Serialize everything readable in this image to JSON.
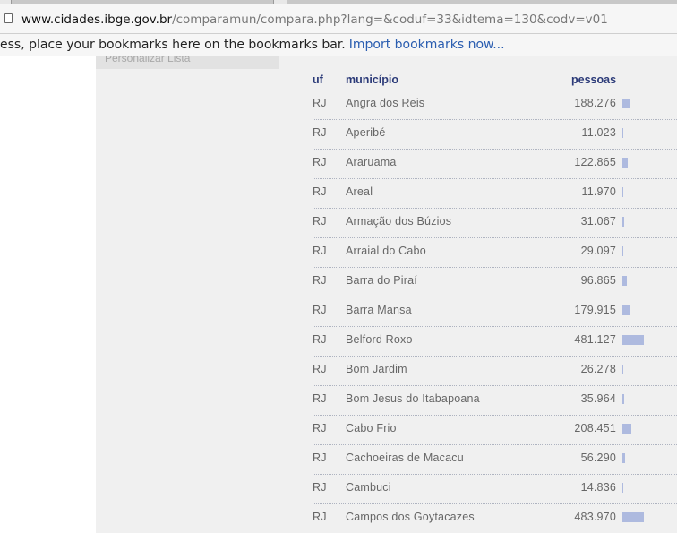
{
  "browser": {
    "url_host": "www.cidades.ibge.gov.br",
    "url_path": "/comparamun/compara.php?lang=&coduf=33&idtema=130&codv=v01",
    "bookmarks_message": "ess, place your bookmarks here on the bookmarks bar.",
    "bookmarks_link": "Import bookmarks now..."
  },
  "sidebar": {
    "item_label": "Personalizar Lista"
  },
  "table": {
    "headers": {
      "uf": "uf",
      "municipio": "município",
      "pessoas": "pessoas"
    },
    "max_value": 483970,
    "rows": [
      {
        "uf": "RJ",
        "municipio": "Angra dos Reis",
        "pessoas": "188.276",
        "value": 188276
      },
      {
        "uf": "RJ",
        "municipio": "Aperibé",
        "pessoas": "11.023",
        "value": 11023
      },
      {
        "uf": "RJ",
        "municipio": "Araruama",
        "pessoas": "122.865",
        "value": 122865
      },
      {
        "uf": "RJ",
        "municipio": "Areal",
        "pessoas": "11.970",
        "value": 11970
      },
      {
        "uf": "RJ",
        "municipio": "Armação dos Búzios",
        "pessoas": "31.067",
        "value": 31067
      },
      {
        "uf": "RJ",
        "municipio": "Arraial do Cabo",
        "pessoas": "29.097",
        "value": 29097
      },
      {
        "uf": "RJ",
        "municipio": "Barra do Piraí",
        "pessoas": "96.865",
        "value": 96865
      },
      {
        "uf": "RJ",
        "municipio": "Barra Mansa",
        "pessoas": "179.915",
        "value": 179915
      },
      {
        "uf": "RJ",
        "municipio": "Belford Roxo",
        "pessoas": "481.127",
        "value": 481127
      },
      {
        "uf": "RJ",
        "municipio": "Bom Jardim",
        "pessoas": "26.278",
        "value": 26278
      },
      {
        "uf": "RJ",
        "municipio": "Bom Jesus do Itabapoana",
        "pessoas": "35.964",
        "value": 35964
      },
      {
        "uf": "RJ",
        "municipio": "Cabo Frio",
        "pessoas": "208.451",
        "value": 208451
      },
      {
        "uf": "RJ",
        "municipio": "Cachoeiras de Macacu",
        "pessoas": "56.290",
        "value": 56290
      },
      {
        "uf": "RJ",
        "municipio": "Cambuci",
        "pessoas": "14.836",
        "value": 14836
      },
      {
        "uf": "RJ",
        "municipio": "Campos dos Goytacazes",
        "pessoas": "483.970",
        "value": 483970
      }
    ]
  }
}
